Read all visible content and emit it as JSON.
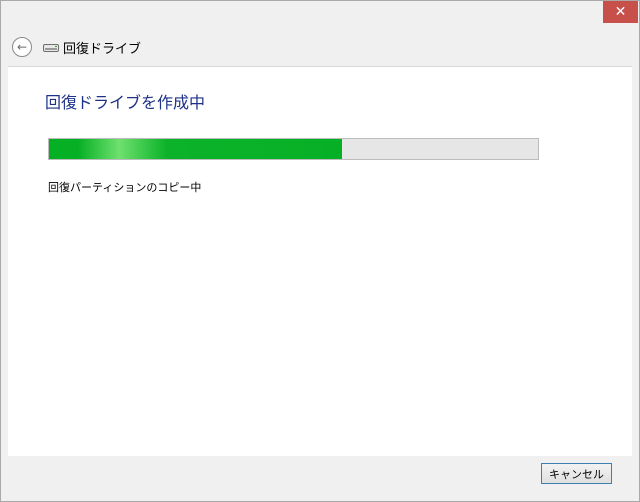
{
  "window": {
    "close_label": "✕"
  },
  "nav": {
    "title": "回復ドライブ",
    "back_glyph": "←"
  },
  "main": {
    "heading": "回復ドライブを作成中",
    "progress_fraction": 0.6,
    "status": "回復パーティションのコピー中"
  },
  "footer": {
    "cancel_label": "キャンセル"
  },
  "colors": {
    "heading": "#1e3287",
    "progress_green": "#06b025",
    "close_red": "#c7504b"
  },
  "icons": {
    "back": "back-arrow-icon",
    "drive": "drive-icon",
    "close": "close-icon"
  }
}
